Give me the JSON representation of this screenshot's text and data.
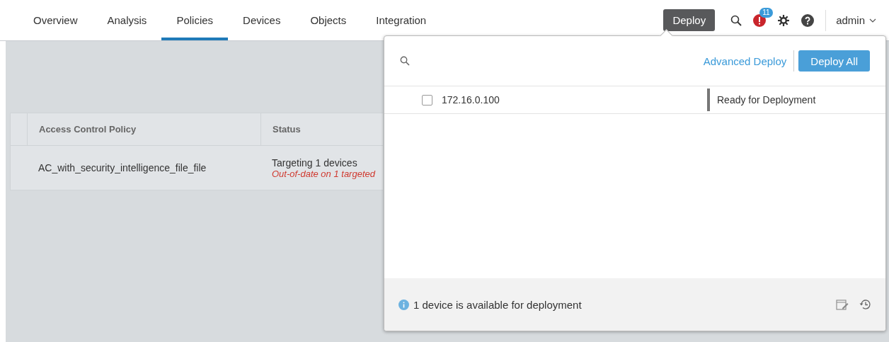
{
  "nav": {
    "items": [
      {
        "label": "Overview",
        "selected": false
      },
      {
        "label": "Analysis",
        "selected": false
      },
      {
        "label": "Policies",
        "selected": true
      },
      {
        "label": "Devices",
        "selected": false
      },
      {
        "label": "Objects",
        "selected": false
      },
      {
        "label": "Integration",
        "selected": false
      }
    ],
    "deploy_button": "Deploy",
    "notification_count": "11",
    "user": "admin"
  },
  "table": {
    "columns": [
      "Access Control Policy",
      "Status"
    ],
    "rows": [
      {
        "policy": "AC_with_security_intelligence_file_file",
        "status": "Targeting 1 devices",
        "status_detail": "Out-of-date on 1 targeted"
      }
    ]
  },
  "deploy_panel": {
    "advanced_link": "Advanced Deploy",
    "deploy_all_button": "Deploy All",
    "devices": [
      {
        "name": "172.16.0.100",
        "checked": false,
        "status": "Ready for Deployment"
      }
    ],
    "footer_message": "1 device is available for deployment"
  }
}
